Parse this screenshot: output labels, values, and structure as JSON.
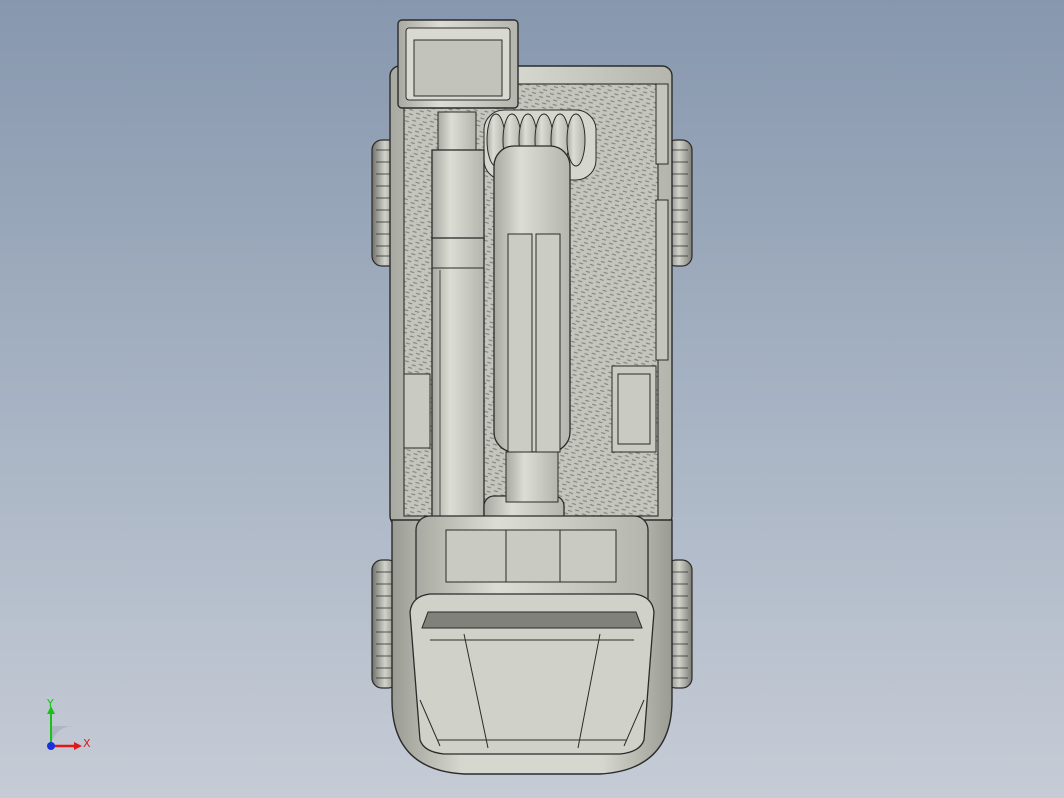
{
  "view": {
    "mode": "shaded-with-edges",
    "colors": {
      "background_top": "#8797ad",
      "background_bottom": "#c6ccd6",
      "part_fill": "#cfd0c7",
      "part_shadow": "#8f918a",
      "edge": "#2b2b2b",
      "tread_plate": "#bfc0b8"
    }
  },
  "model": {
    "name_icon": "truck-crane-top-view-icon"
  },
  "triad": {
    "x_label": "X",
    "y_label": "Y",
    "x_color": "#e01818",
    "y_color": "#18c018",
    "z_color": "#1830e0"
  }
}
